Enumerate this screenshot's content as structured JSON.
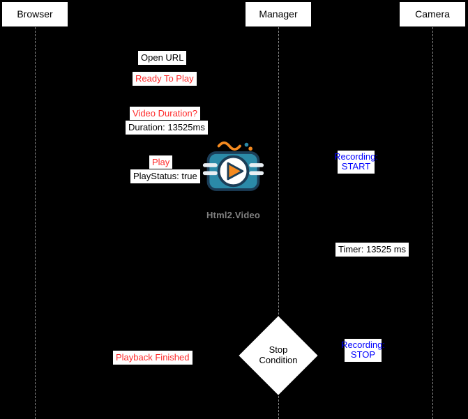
{
  "actors": {
    "browser": "Browser",
    "manager": "Manager",
    "camera": "Camera"
  },
  "messages": {
    "open_url": "Open URL",
    "ready_to_play": "Ready To Play",
    "video_duration": "Video Duration?",
    "duration_reply": "Duration: 13525ms",
    "play": "Play",
    "play_status": "PlayStatus: true",
    "recording_start": "Recording: START",
    "timer": "Timer: 13525 ms",
    "recording_stop": "Recording: STOP",
    "playback_finished": "Playback Finished",
    "stop_condition": "Stop Condition"
  },
  "logo_caption": "Html2.Video"
}
